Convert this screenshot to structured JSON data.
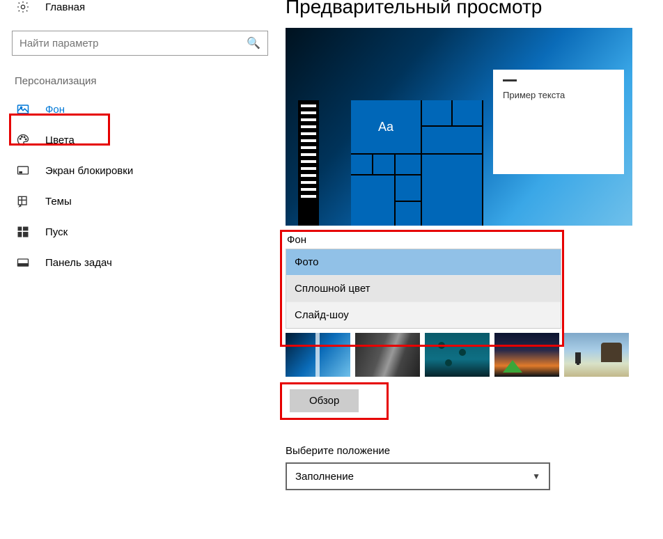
{
  "sidebar": {
    "home": "Главная",
    "search_placeholder": "Найти параметр",
    "section": "Персонализация",
    "items": [
      {
        "label": "Фон"
      },
      {
        "label": "Цвета"
      },
      {
        "label": "Экран блокировки"
      },
      {
        "label": "Темы"
      },
      {
        "label": "Пуск"
      },
      {
        "label": "Панель задач"
      }
    ]
  },
  "content": {
    "preview_title": "Предварительный просмотр",
    "preview_sample_text": "Пример текста",
    "aa": "Aa",
    "background_label": "Фон",
    "background_options": {
      "photo": "Фото",
      "solid": "Сплошной цвет",
      "slideshow": "Слайд-шоу"
    },
    "browse_label": "Обзор",
    "fit_label": "Выберите положение",
    "fit_value": "Заполнение"
  }
}
